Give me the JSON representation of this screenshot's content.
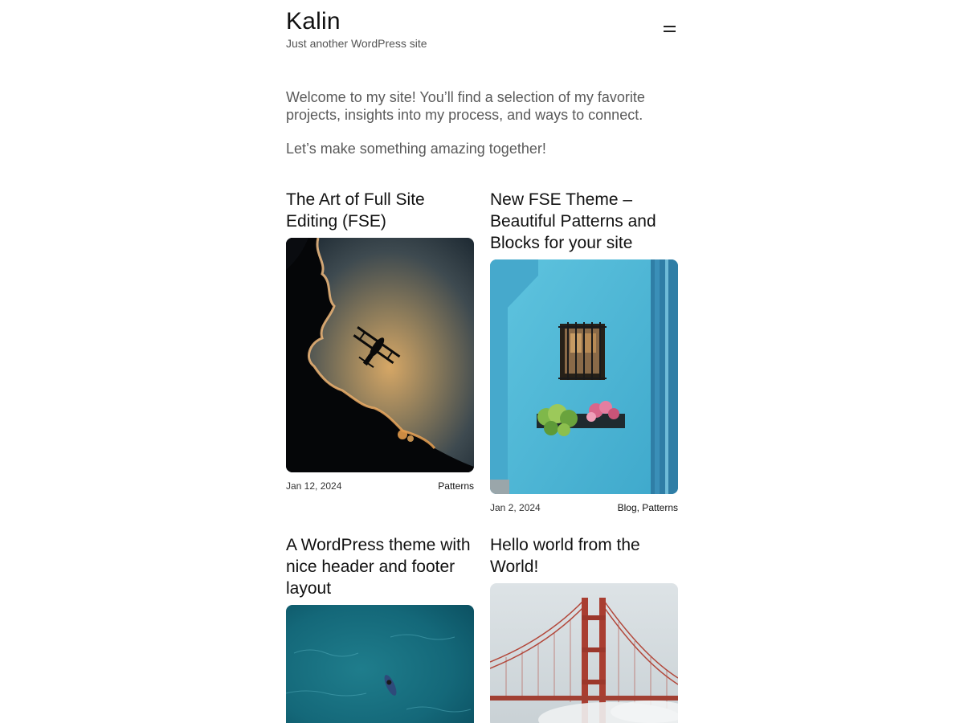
{
  "site": {
    "title": "Kalin",
    "tagline": "Just another WordPress site"
  },
  "intro": {
    "paragraph1": "Welcome to my site! You’ll find a selection of my favorite projects, insights into my process, and ways to connect.",
    "paragraph2": "Let’s make something amazing together!"
  },
  "menu": {
    "icon": "hamburger-menu-icon"
  },
  "posts": [
    {
      "title": "The Art of Full Site Editing (FSE)",
      "date": "Jan 12, 2024",
      "categories": "Patterns",
      "image": "biplane-silhouette-sky"
    },
    {
      "title": "New FSE Theme – Beautiful Patterns and Blocks for your site",
      "date": "Jan 2, 2024",
      "categories": "Blog, Patterns",
      "image": "blue-wall-window-flowers"
    },
    {
      "title": "A WordPress theme with nice header and footer layout",
      "image": "ocean-surfer-aerial"
    },
    {
      "title": "Hello world from the World!",
      "image": "red-suspension-bridge-fog"
    }
  ],
  "colors": {
    "text": "#111111",
    "muted": "#5a5a5a",
    "background": "#ffffff"
  }
}
